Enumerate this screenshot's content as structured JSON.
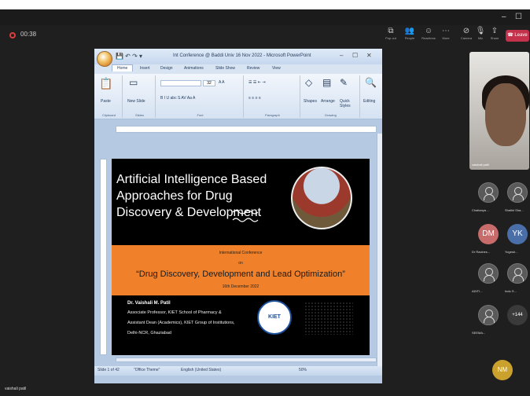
{
  "meeting": {
    "timer": "00:38",
    "toolbar": [
      "Pop out",
      "People",
      "Reactions",
      "More",
      "",
      "Camera",
      "Mic",
      "Share"
    ],
    "leave": "Leave"
  },
  "ppt": {
    "doc_title": "Int Conference @ Baddi Univ 16 Nov 2022 - Microsoft PowerPoint",
    "tabs": [
      "Home",
      "Insert",
      "Design",
      "Animations",
      "Slide Show",
      "Review",
      "View"
    ],
    "ribbon": {
      "paste": "Paste",
      "new_slide": "New Slide",
      "shapes": "Shapes",
      "arrange": "Arrange",
      "quick_styles": "Quick Styles",
      "editing": "Editing",
      "font_size": "32"
    },
    "groups": [
      "Clipboard",
      "Slides",
      "Font",
      "Paragraph",
      "Drawing"
    ],
    "status": {
      "slide": "Slide 1 of 42",
      "theme": "\"Office Theme\"",
      "language": "English (United States)",
      "zoom": "50%"
    }
  },
  "slide": {
    "title": "Artificial Intelligence Based Approaches for Drug Discovery & Development",
    "conf": "International Conference",
    "on": "on",
    "theme": "“Drug Discovery, Development and Lead Optimization”",
    "date": "16th December 2022",
    "presenter": "Dr. Vaishali M. Patil",
    "lines": [
      "Associate Professor, KIET School of Pharmacy &",
      "Assistant Dean (Academics), KIET Group of Institutions,",
      "Delhi-NCR, Ghaziabad"
    ],
    "logo": "KIET"
  },
  "participants": {
    "self": "vaishali patil",
    "list": [
      {
        "initials": "",
        "name": "Chaitanya ..."
      },
      {
        "initials": "",
        "name": "Shalini Sha..."
      },
      {
        "initials": "DM",
        "name": "Dr Ravines..."
      },
      {
        "initials": "YK",
        "name": "Yogesh..."
      },
      {
        "initials": "",
        "name": "ADITI..."
      },
      {
        "initials": "",
        "name": "Indu S..."
      },
      {
        "initials": "",
        "name": "SEEMA..."
      },
      {
        "initials": "+144",
        "name": ""
      }
    ],
    "nm": "NM",
    "bottom_name": "vaishali patil"
  },
  "colors": {
    "dm": "#c76b6b",
    "yk": "#4a6fa8",
    "nm": "#c9a12c",
    "orange": "#f0812a"
  }
}
